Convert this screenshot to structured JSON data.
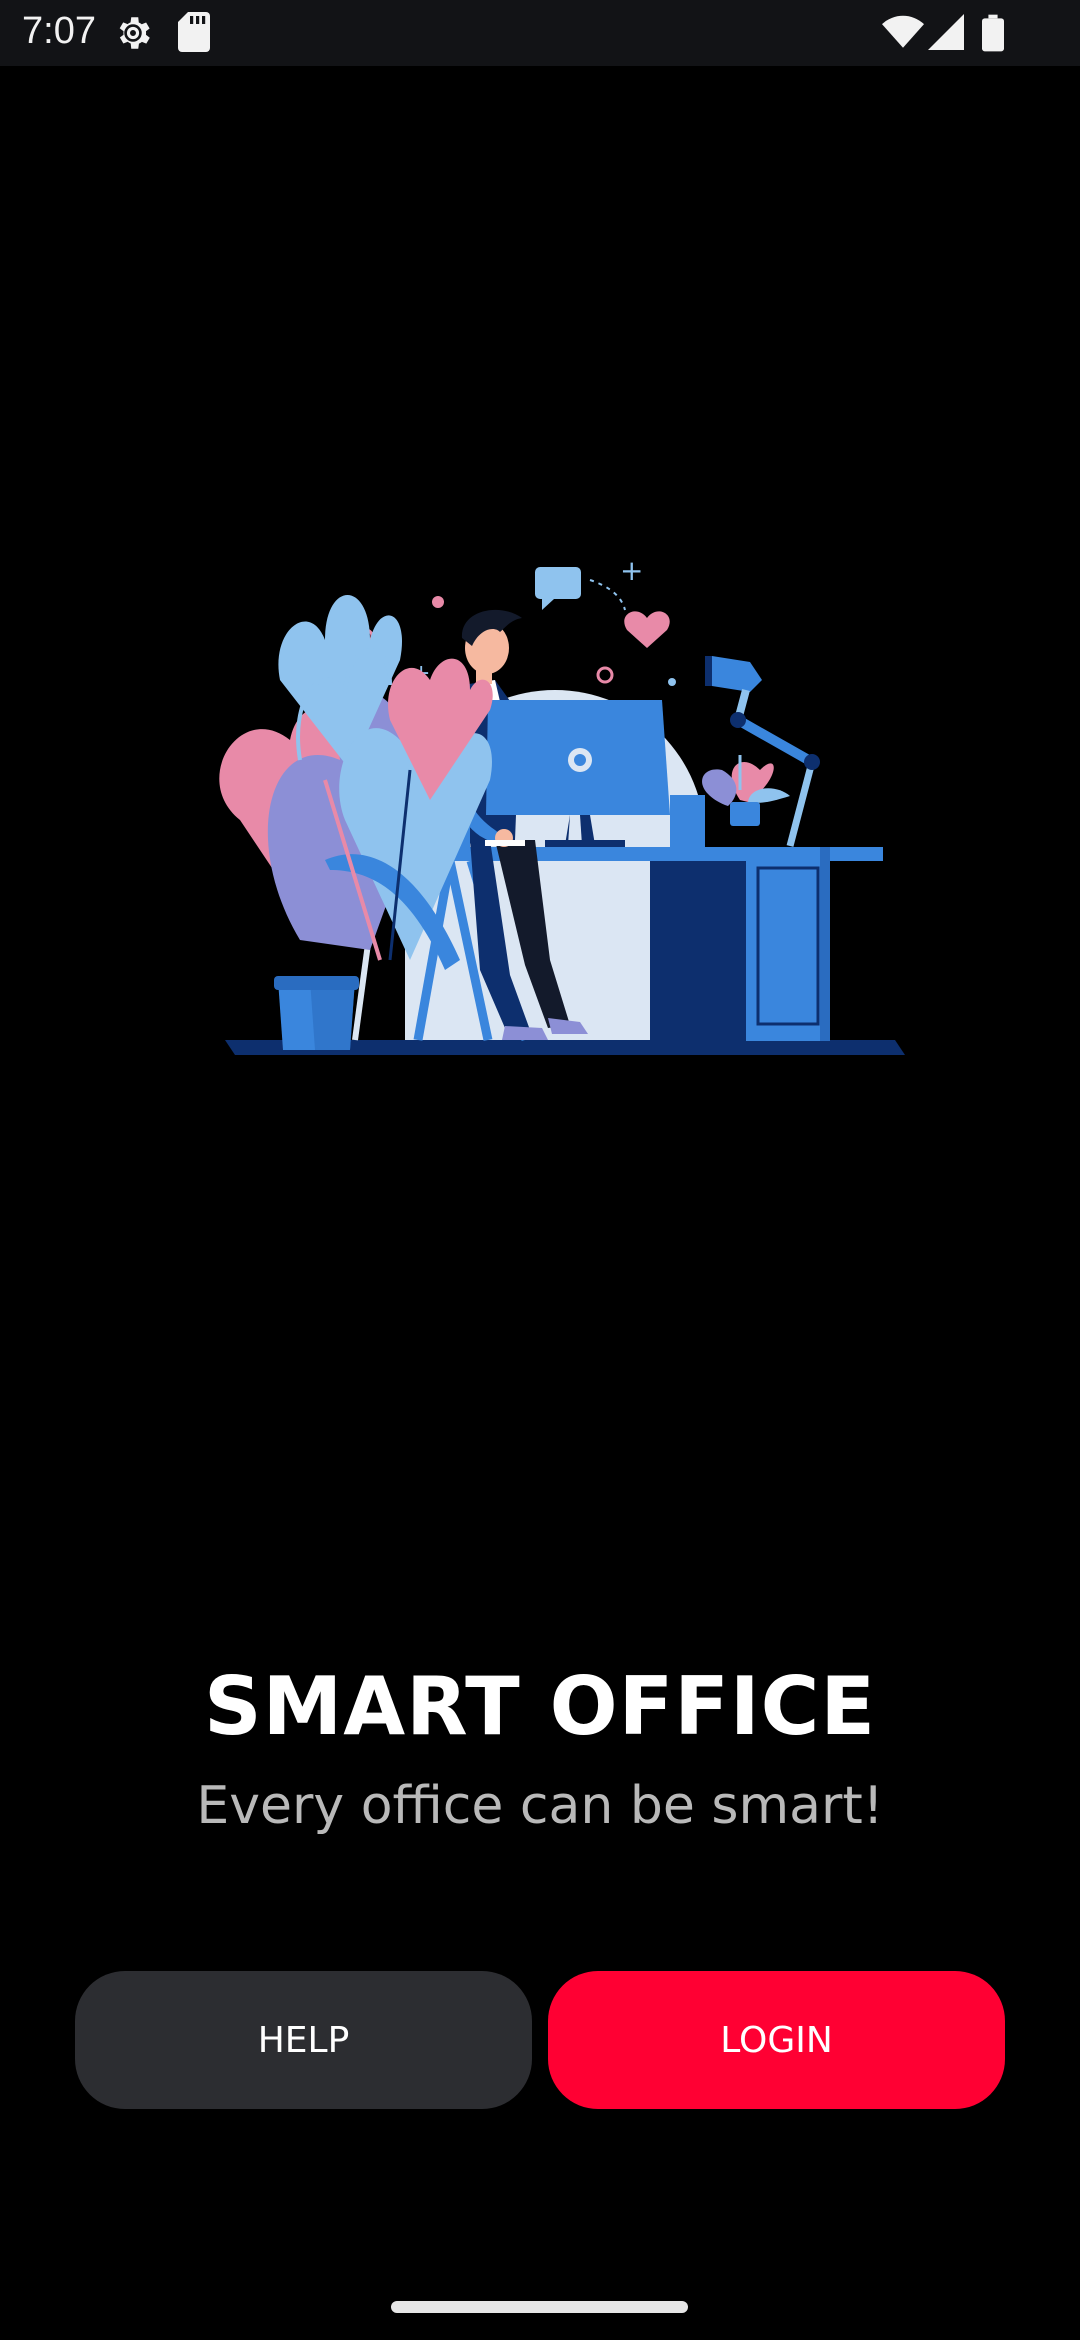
{
  "status_bar": {
    "time": "7:07",
    "left_icons": [
      "settings-gear-icon",
      "sd-card-icon"
    ],
    "right_icons": [
      "wifi-icon",
      "cell-signal-icon",
      "battery-icon"
    ]
  },
  "illustration": {
    "icon": "office-worker-illustration",
    "colors": {
      "primary_blue": "#3a86dd",
      "dark_blue": "#0d2f6e",
      "light_blue": "#8fc3ee",
      "pink": "#e88aa8",
      "purple": "#8c8fd6"
    }
  },
  "hero": {
    "title": "SMART OFFICE",
    "subtitle": "Every office can be smart!"
  },
  "actions": {
    "help_label": "HELP",
    "login_label": "LOGIN",
    "login_color": "#ff0033",
    "help_color": "#2c2d31"
  }
}
